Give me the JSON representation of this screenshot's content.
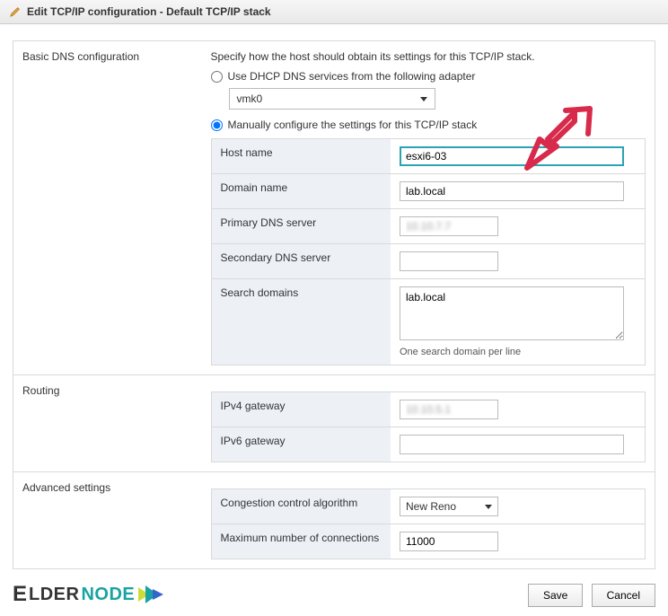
{
  "titlebar": {
    "title": "Edit TCP/IP configuration - Default TCP/IP stack"
  },
  "sections": {
    "dns": {
      "label": "Basic DNS configuration",
      "instruction": "Specify how the host should obtain its settings for this TCP/IP stack.",
      "radio_dhcp": "Use DHCP DNS services from the following adapter",
      "adapter_value": "vmk0",
      "radio_manual": "Manually configure the settings for this TCP/IP stack",
      "fields": {
        "host_name": {
          "label": "Host name",
          "value": "esxi6-03"
        },
        "domain_name": {
          "label": "Domain name",
          "value": "lab.local"
        },
        "primary_dns": {
          "label": "Primary DNS server",
          "value": "10.10.7.7"
        },
        "secondary_dns": {
          "label": "Secondary DNS server",
          "value": ""
        },
        "search_domains": {
          "label": "Search domains",
          "value": "lab.local",
          "hint": "One search domain per line"
        }
      }
    },
    "routing": {
      "label": "Routing",
      "fields": {
        "ipv4_gw": {
          "label": "IPv4 gateway",
          "value": "10.10.5.1"
        },
        "ipv6_gw": {
          "label": "IPv6 gateway",
          "value": ""
        }
      }
    },
    "advanced": {
      "label": "Advanced settings",
      "fields": {
        "congestion": {
          "label": "Congestion control algorithm",
          "value": "New Reno"
        },
        "max_conn": {
          "label": "Maximum number of connections",
          "value": "11000"
        }
      }
    }
  },
  "buttons": {
    "save": "Save",
    "cancel": "Cancel"
  },
  "brand": {
    "e": "E",
    "lder": "LDER",
    "node": "NODE"
  }
}
